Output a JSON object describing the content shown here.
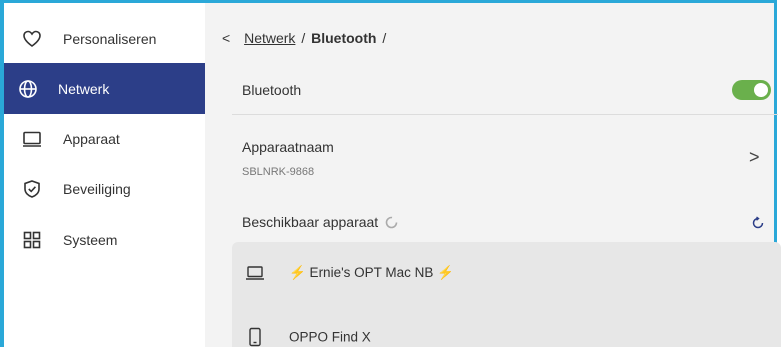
{
  "sidebar": {
    "items": [
      {
        "label": "Personaliseren",
        "icon": "heart-icon"
      },
      {
        "label": "Netwerk",
        "icon": "globe-icon",
        "active": true
      },
      {
        "label": "Apparaat",
        "icon": "monitor-icon"
      },
      {
        "label": "Beveiliging",
        "icon": "shield-check-icon"
      },
      {
        "label": "Systeem",
        "icon": "grid-icon"
      }
    ]
  },
  "breadcrumb": {
    "back": "<",
    "parent": "Netwerk",
    "separator": "/",
    "current": "Bluetooth",
    "trailing": "/"
  },
  "bluetooth": {
    "label": "Bluetooth",
    "enabled": true
  },
  "device_name": {
    "label": "Apparaatnaam",
    "value": "SBLNRK-9868",
    "chevron": ">"
  },
  "available": {
    "label": "Beschikbaar apparaat"
  },
  "devices": [
    {
      "name": "⚡ Ernie's OPT Mac NB ⚡",
      "icon": "laptop-icon"
    },
    {
      "name": "OPPO Find X",
      "icon": "phone-icon"
    }
  ],
  "colors": {
    "accent": "#2c3e88",
    "toggle_on": "#6ab04c",
    "frame": "#2aa8d8"
  }
}
